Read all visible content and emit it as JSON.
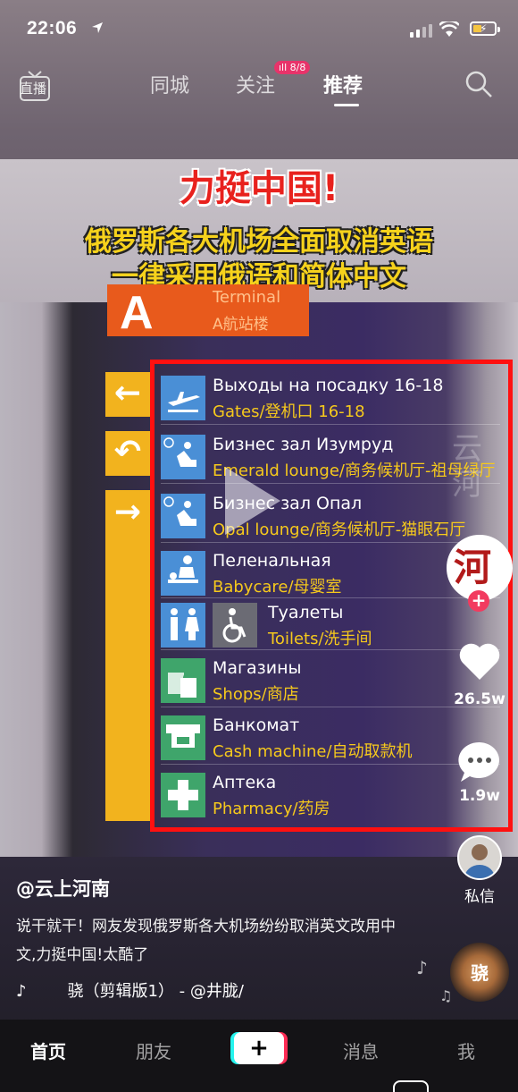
{
  "status_bar": {
    "time": "22:06"
  },
  "top_nav": {
    "live": "直播",
    "tabs": [
      {
        "label": "同城",
        "active": false
      },
      {
        "label": "关注",
        "active": false
      },
      {
        "label": "推荐",
        "active": true
      }
    ],
    "follow_badge": "8/8"
  },
  "video": {
    "headline": "力挺中国!",
    "subtitle_line1": "俄罗斯各大机场全面取消英语",
    "subtitle_line2": "一律采用俄语和简体中文",
    "terminal": {
      "letter": "A",
      "en": "Terminal",
      "cn": "A航站楼"
    },
    "signs": [
      {
        "ru": "Выходы на посадку 16-18",
        "cn": "Gates/登机口 16-18"
      },
      {
        "ru": "Бизнес зал Изумруд",
        "cn": "Emerald lounge/商务候机厅-祖母绿厅"
      },
      {
        "ru": "Бизнес зал Опал",
        "cn": "Opal lounge/商务候机厅-猫眼石厅"
      },
      {
        "ru": "Пеленальная",
        "cn": "Babycare/母婴室"
      },
      {
        "ru": "Туалеты",
        "cn": "Toilets/洗手间"
      },
      {
        "ru": "Магазины",
        "cn": "Shops/商店"
      },
      {
        "ru": "Банкомат",
        "cn": "Cash machine/自动取款机"
      },
      {
        "ru": "Аптека",
        "cn": "Pharmacy/药房"
      }
    ],
    "watermark": "云 河"
  },
  "side": {
    "avatar_text": "河南",
    "likes": "26.5w",
    "comments": "1.9w",
    "dm_label": "私信",
    "disc_text": "骁"
  },
  "caption": {
    "author": "@云上河南",
    "description": "说干就干！网友发现俄罗斯各大机场纷纷取消英文改用中文,力挺中国!太酷了",
    "music": "骁（剪辑版1） - @井胧/"
  },
  "bottom_nav": {
    "items": [
      {
        "label": "首页",
        "active": true
      },
      {
        "label": "朋友",
        "active": false
      },
      {
        "label": "消息",
        "active": false
      },
      {
        "label": "我",
        "active": false
      }
    ],
    "plus": "+"
  },
  "colors": {
    "accent_red": "#fe2c55",
    "accent_cyan": "#25f4ee",
    "highlight_box": "#ff1010",
    "sign_yellow": "#f6c91c"
  }
}
